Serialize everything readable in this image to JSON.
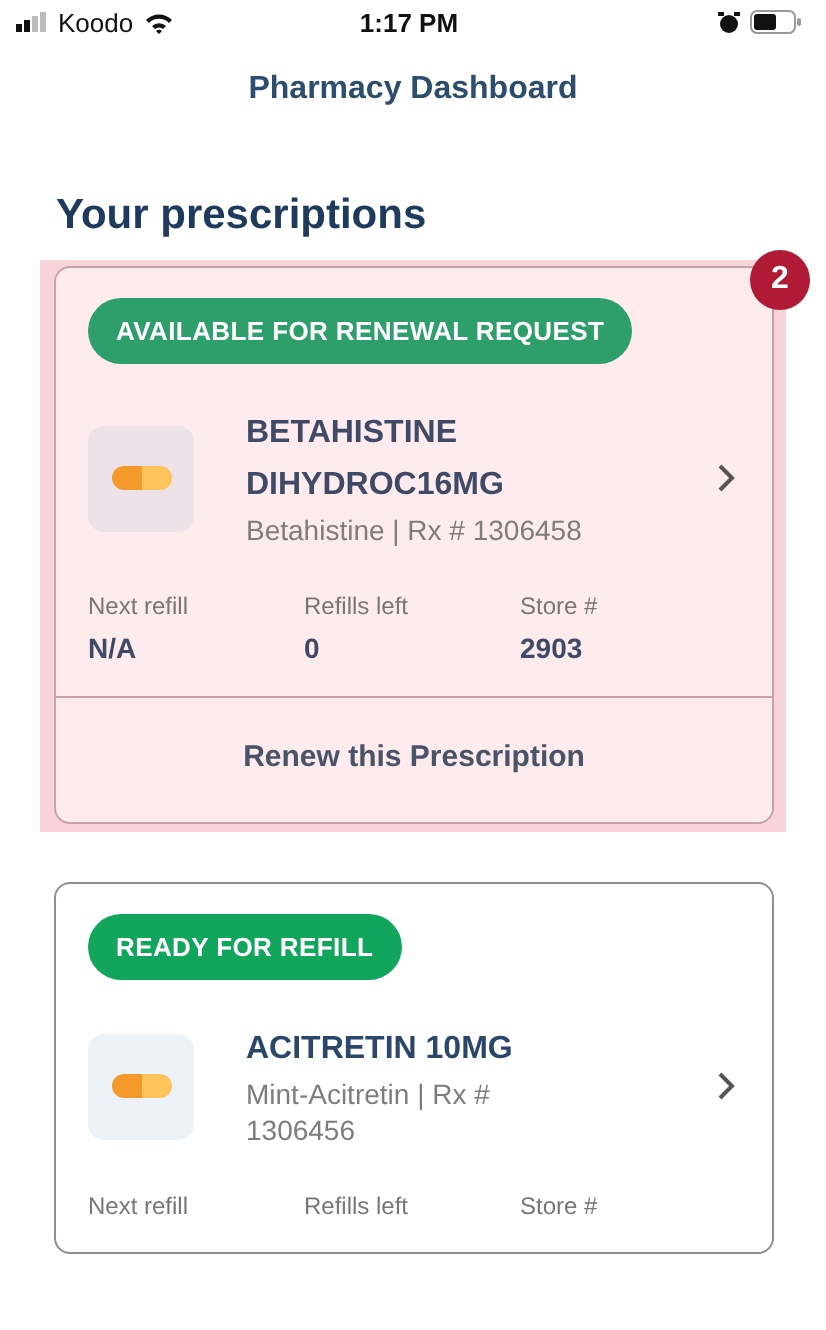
{
  "status_bar": {
    "carrier": "Koodo",
    "time": "1:17 PM"
  },
  "header": {
    "title": "Pharmacy Dashboard"
  },
  "section_title": "Your prescriptions",
  "prescriptions": [
    {
      "status": "AVAILABLE FOR RENEWAL REQUEST",
      "color": "#2e9e6b",
      "highlighted": true,
      "annotation": "2",
      "name": "BETAHISTINE DIHYDROC16MG",
      "detail": "Betahistine | Rx # 1306458",
      "stats": [
        {
          "label": "Next refill",
          "value": "N/A"
        },
        {
          "label": "Refills left",
          "value": "0"
        },
        {
          "label": "Store #",
          "value": "2903"
        }
      ],
      "action": "Renew this Prescription"
    },
    {
      "status": "READY FOR REFILL",
      "color": "#12a65d",
      "highlighted": false,
      "name": "ACITRETIN 10MG",
      "detail": "Mint-Acitretin | Rx # 1306456",
      "stats": [
        {
          "label": "Next refill"
        },
        {
          "label": "Refills left"
        },
        {
          "label": "Store #"
        }
      ]
    }
  ]
}
